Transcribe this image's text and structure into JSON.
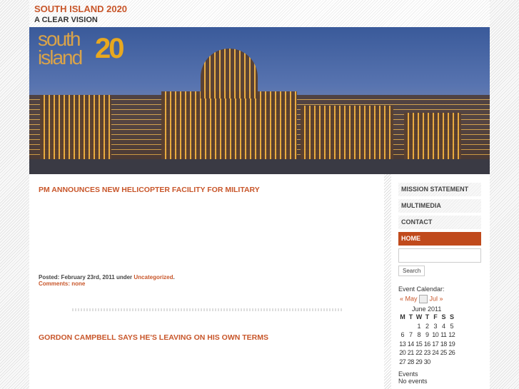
{
  "header": {
    "title": "SOUTH ISLAND 2020",
    "tagline": "A CLEAR VISION"
  },
  "banner": {
    "logo_word1": "south",
    "logo_word2": "island",
    "logo_num": "20"
  },
  "posts": [
    {
      "title": "PM ANNOUNCES NEW HELICOPTER FACILITY FOR MILITARY",
      "posted": "Posted: February 23rd, 2011 under ",
      "category": "Uncategorized",
      "comments": "Comments: none"
    },
    {
      "title": "GORDON CAMPBELL SAYS HE'S LEAVING ON HIS OWN TERMS"
    }
  ],
  "sidebar": {
    "nav": [
      "MISSION STATEMENT",
      "MULTIMEDIA",
      "CONTACT",
      "HOME"
    ],
    "search_value": "",
    "search_button": "Search",
    "calendar_label": "Event Calendar:",
    "prev": "« May",
    "next": "Jul »",
    "month": "June 2011",
    "days": [
      "M",
      "T",
      "W",
      "T",
      "F",
      "S",
      "S"
    ],
    "weeks": [
      [
        "",
        "",
        "1",
        "2",
        "3",
        "4",
        "5"
      ],
      [
        "6",
        "7",
        "8",
        "9",
        "10",
        "11",
        "12"
      ],
      [
        "13",
        "14",
        "15",
        "16",
        "17",
        "18",
        "19"
      ],
      [
        "20",
        "21",
        "22",
        "23",
        "24",
        "25",
        "26"
      ],
      [
        "27",
        "28",
        "29",
        "30",
        "",
        "",
        ""
      ]
    ],
    "events_label": "Events",
    "events_value": "No events"
  }
}
